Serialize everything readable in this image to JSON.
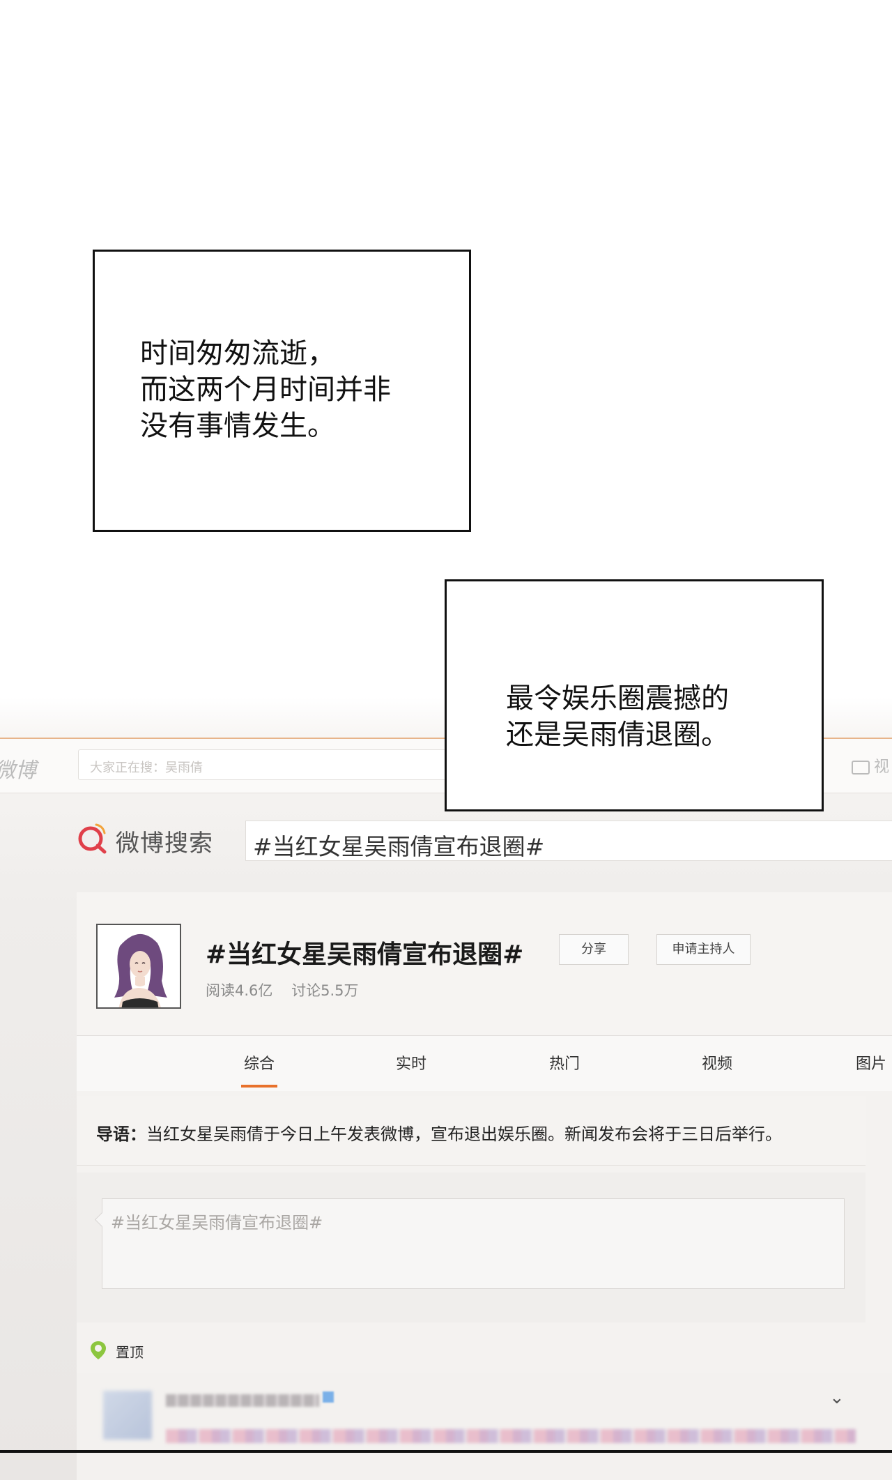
{
  "captions": {
    "first": "时间匆匆流逝，\n而这两个月时间并非\n没有事情发生。",
    "second": "最令娱乐圈震撼的\n还是吴雨倩退圈。"
  },
  "weibo_topbar": {
    "brand_partial": "微博",
    "search_placeholder": "大家正在搜：吴雨倩",
    "video_label": "视"
  },
  "weibo_search": {
    "title": "微博搜索",
    "query": "#当红女星吴雨倩宣布退圈#"
  },
  "topic": {
    "title": "#当红女星吴雨倩宣布退圈#",
    "share_label": "分享",
    "host_label": "申请主持人",
    "reads": "阅读4.6亿",
    "discussions": "讨论5.5万"
  },
  "tabs": [
    "综合",
    "实时",
    "热门",
    "视频",
    "图片"
  ],
  "intro": {
    "label": "导语：",
    "text": "当红女星吴雨倩于今日上午发表微博，宣布退出娱乐圈。新闻发布会将于三日后举行。"
  },
  "compose": {
    "placeholder": "#当红女星吴雨倩宣布退圈#"
  },
  "pinned": {
    "label": "置顶"
  },
  "colors": {
    "accent_orange": "#e8712b",
    "logo_red": "#e0404a",
    "pin_green": "#8cc63f"
  }
}
